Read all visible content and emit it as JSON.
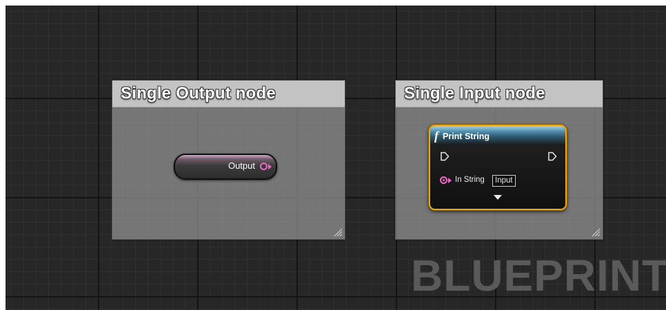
{
  "comments": [
    {
      "title": "Single Output node"
    },
    {
      "title": "Single Input node"
    }
  ],
  "reroute_node": {
    "label": "Output"
  },
  "print_string_node": {
    "title": "Print String",
    "function_icon": "f",
    "pin_label": "In String",
    "pin_value": "Input"
  },
  "watermark": "BLUEPRINT",
  "colors": {
    "grid_background": "#272727",
    "comment_body": "#8f8f8f",
    "comment_header": "#c3c3c3",
    "string_pin": "#ee68c6",
    "selection_outline": "#f0a80c",
    "function_header": "#4e8aa8"
  }
}
